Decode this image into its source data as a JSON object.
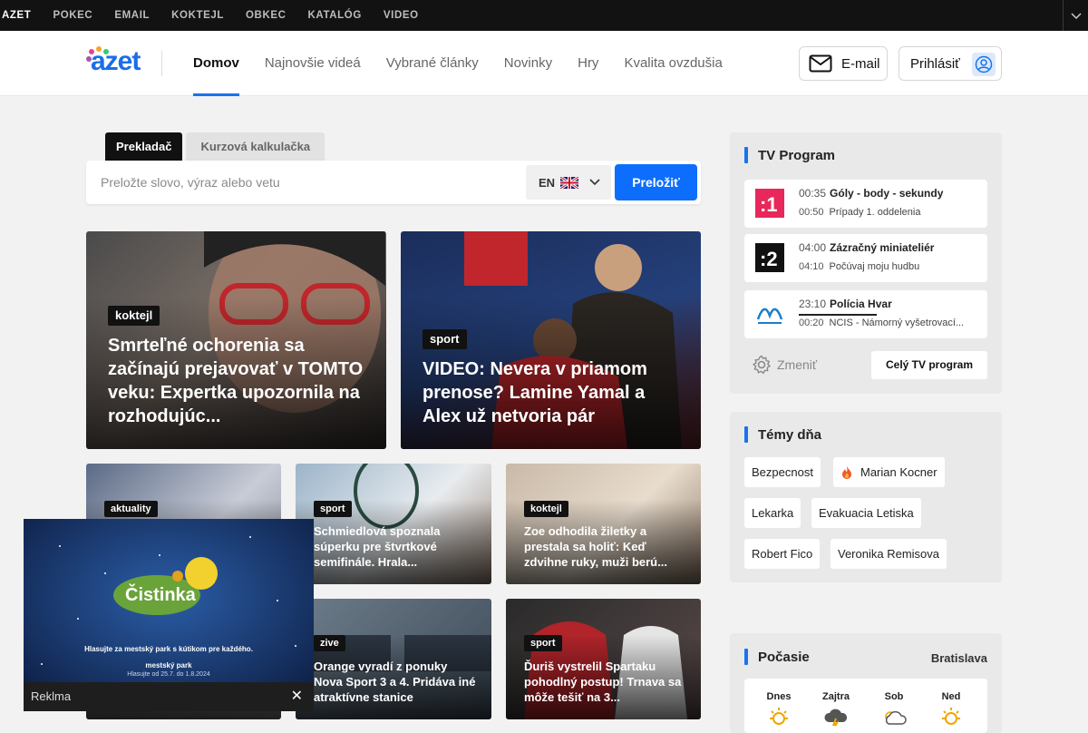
{
  "topbar": {
    "items": [
      "AZET",
      "POKEC",
      "EMAIL",
      "KOKTEJL",
      "OBKEC",
      "KATALÓG",
      "VIDEO"
    ]
  },
  "header": {
    "logo_text": "azet",
    "nav": [
      "Domov",
      "Najnovšie videá",
      "Vybrané články",
      "Novinky",
      "Hry",
      "Kvalita ovzdušia"
    ],
    "email_label": "E-mail",
    "login_label": "Prihlásiť"
  },
  "translator": {
    "tabs": [
      "Prekladač",
      "Kurzová kalkulačka"
    ],
    "placeholder": "Preložte slovo, výraz alebo vetu",
    "lang": "EN",
    "button": "Preložiť"
  },
  "articles_big": [
    {
      "tag": "koktejl",
      "title": "Smrteľné ochorenia sa začínajú prejavovať v TOMTO veku: Expertka upozornila na rozhodujúc..."
    },
    {
      "tag": "sport",
      "title": "VIDEO: Nevera v priamom prenose? Lamine Yamal a Alex už netvoria pár"
    }
  ],
  "articles_small": [
    {
      "tag": "aktuality",
      "title": ""
    },
    {
      "tag": "sport",
      "title": "Schmiedlová spoznala súperku pre štvrtkové semifinále. Hrala..."
    },
    {
      "tag": "koktejl",
      "title": "Zoe odhodila žiletky a prestala sa holiť: Keď zdvihne ruky, muži berú..."
    },
    {
      "tag": "",
      "title": ""
    },
    {
      "tag": "zive",
      "title": "Orange vyradí z ponuky Nova Sport 3 a 4. Pridáva iné atraktívne stanice"
    },
    {
      "tag": "sport",
      "title": "Ďuriš vystrelil Spartaku pohodlný postup! Trnava sa môže tešiť na 3..."
    }
  ],
  "tv": {
    "title": "TV Program",
    "rows": [
      {
        "channel": "jednotka",
        "time1": "00:35",
        "show1": "Góly - body - sekundy",
        "time2": "00:50",
        "show2": "Prípady 1. oddelenia"
      },
      {
        "channel": "dvojka",
        "time1": "04:00",
        "show1": "Zázračný miniateliér",
        "time2": "04:10",
        "show2": "Počúvaj moju hudbu"
      },
      {
        "channel": "markiza",
        "time1": "23:10",
        "show1": "Polícia Hvar",
        "time2": "00:20",
        "show2": "NCIS - Námorný vyšetrovací..."
      }
    ],
    "change": "Zmeniť",
    "full": "Celý TV program"
  },
  "topics": {
    "title": "Témy dňa",
    "items": [
      "Bezpecnost",
      "Marian Kocner",
      "Lekarka",
      "Evakuacia Letiska",
      "Robert Fico",
      "Veronika Remisova"
    ]
  },
  "weather": {
    "title": "Počasie",
    "city": "Bratislava",
    "days": [
      "Dnes",
      "Zajtra",
      "Sob",
      "Ned"
    ]
  },
  "ad": {
    "brand": "Čistinka",
    "text1": "Hlasujte za mestský park s kútikom pre každého.",
    "text2": "mestský park",
    "text3": "Hlasujte od 25.7. do 1.8.2024",
    "label": "Reklma",
    "close": "✕"
  }
}
